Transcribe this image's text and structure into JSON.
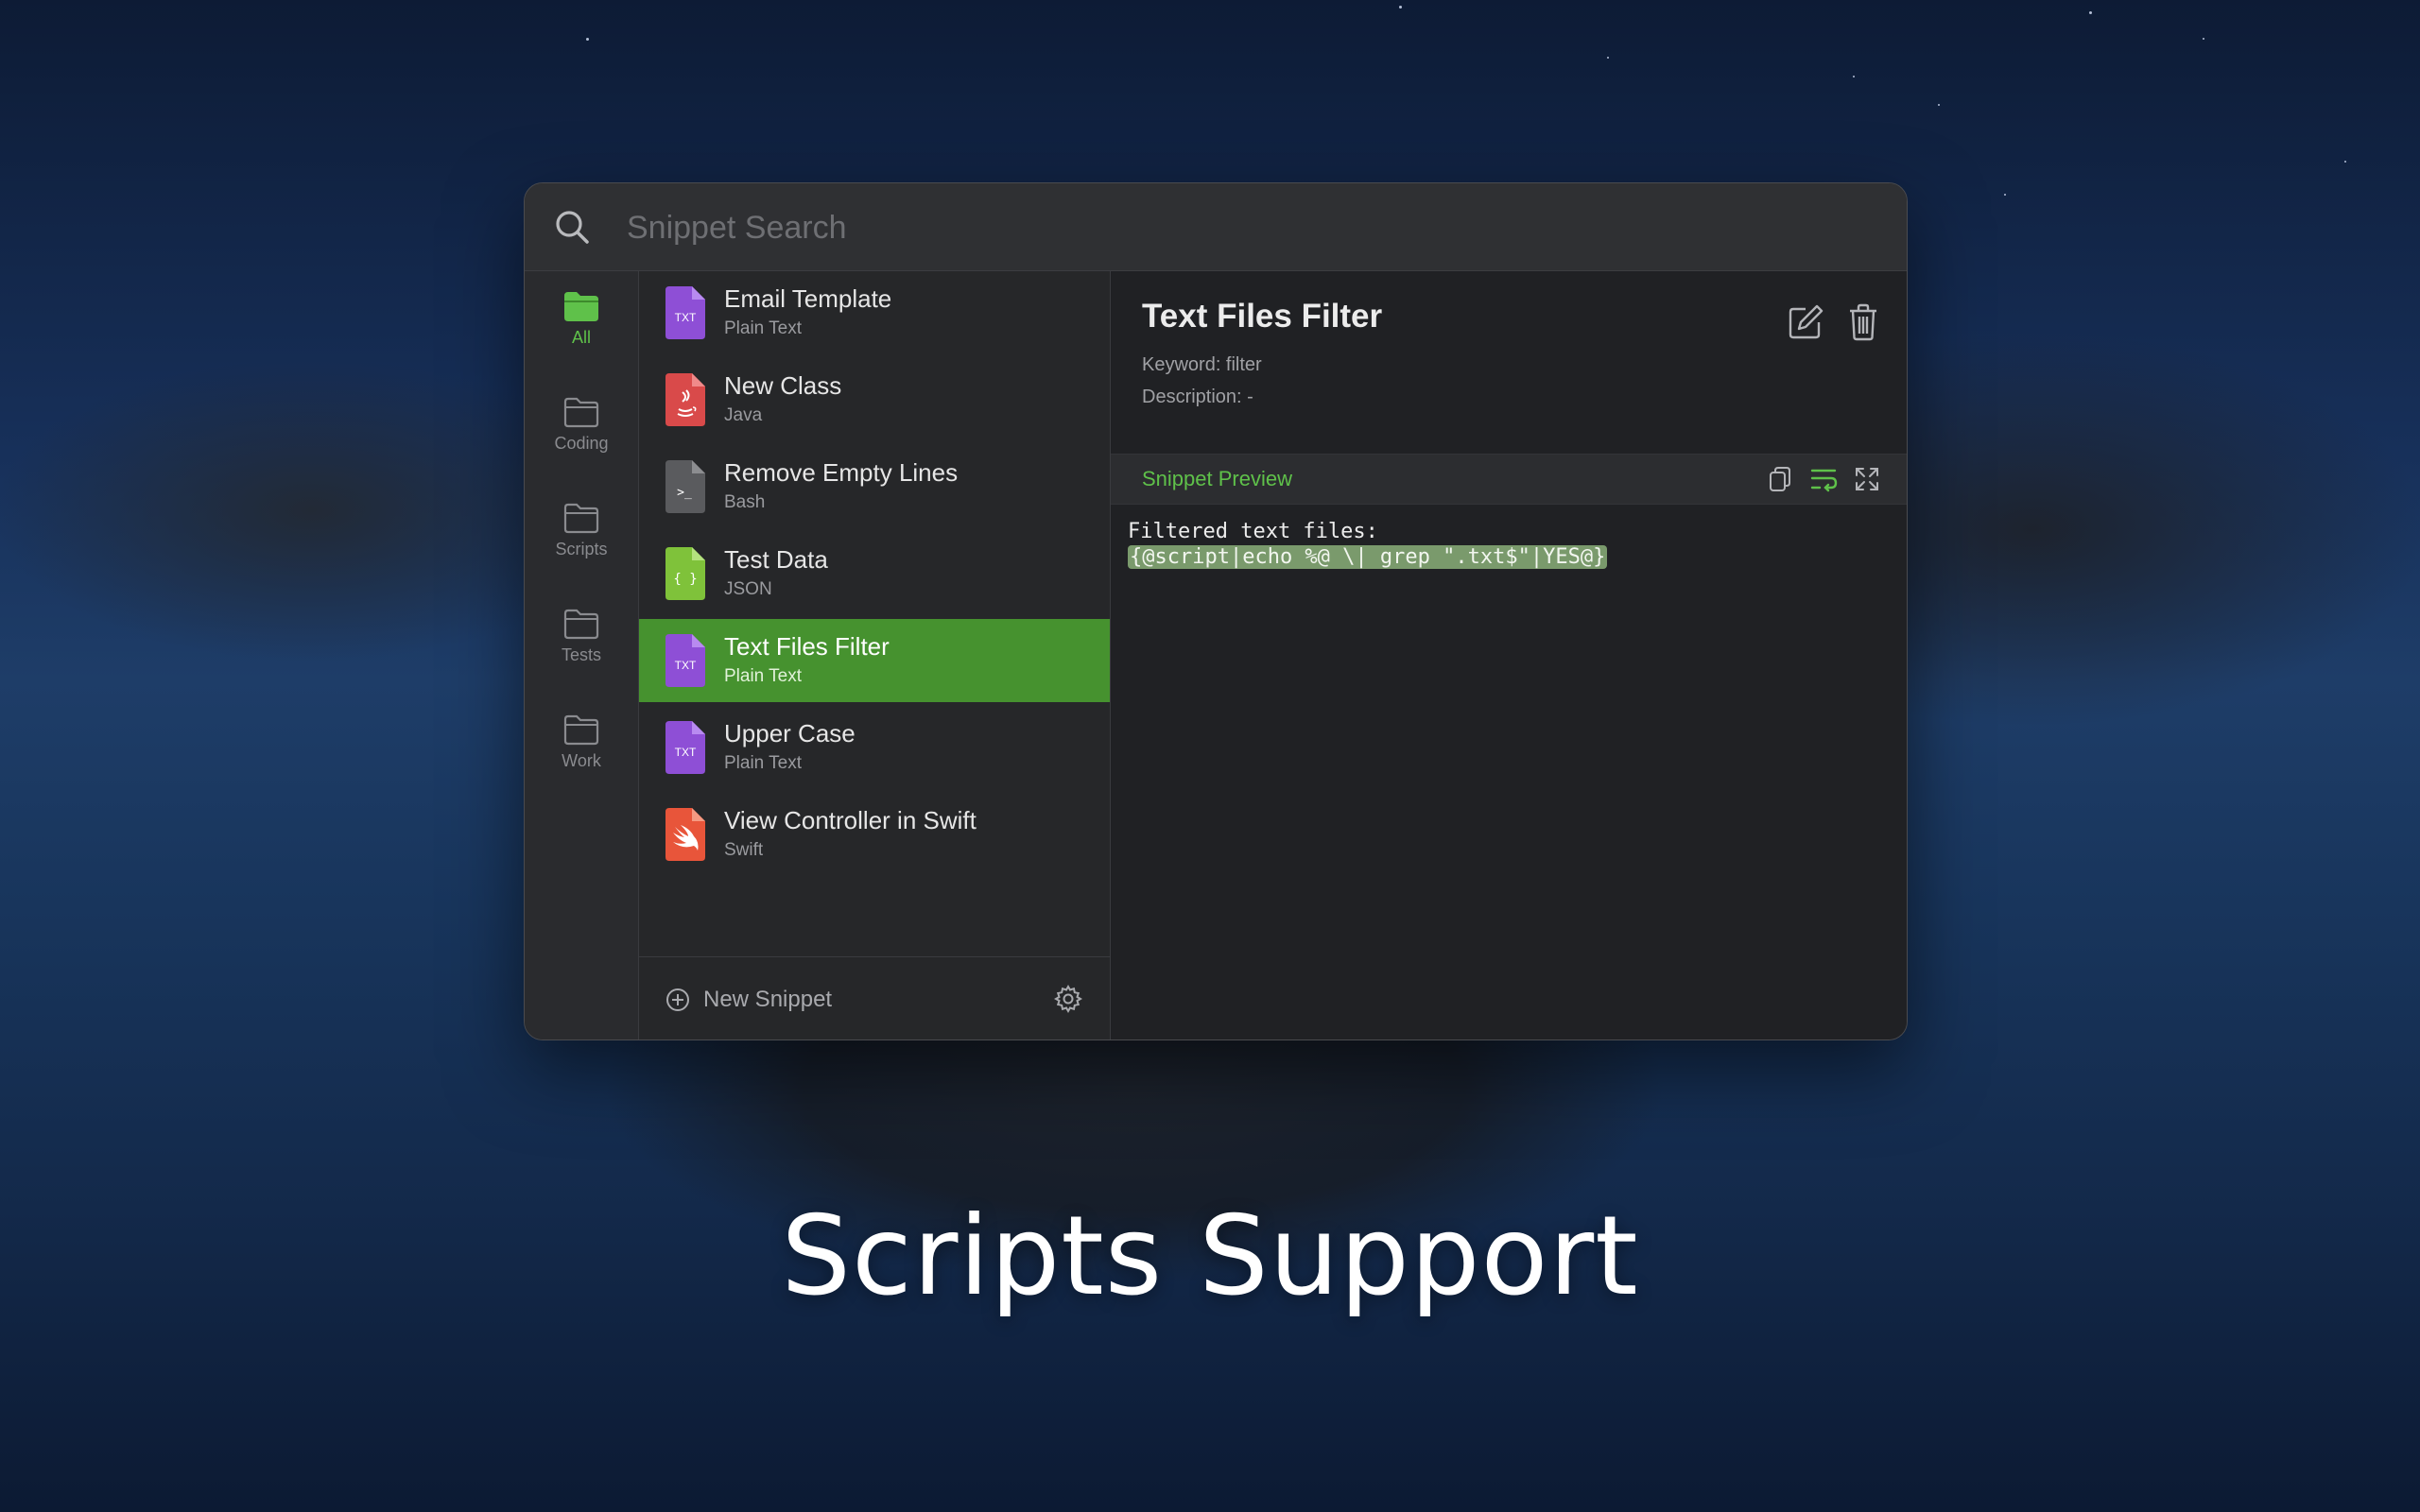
{
  "search": {
    "placeholder": "Snippet Search"
  },
  "sidebar": {
    "items": [
      {
        "label": "All",
        "active": true
      },
      {
        "label": "Coding"
      },
      {
        "label": "Scripts"
      },
      {
        "label": "Tests"
      },
      {
        "label": "Work"
      }
    ]
  },
  "snippets": [
    {
      "title": "Email Template",
      "type": "Plain Text",
      "icon": "txt-file-icon",
      "badge": "TXT",
      "color": "#8e4fd6"
    },
    {
      "title": "New Class",
      "type": "Java",
      "icon": "java-file-icon",
      "color": "#d94a4a"
    },
    {
      "title": "Remove Empty Lines",
      "type": "Bash",
      "icon": "bash-file-icon",
      "badge": ">_",
      "color": "#5a5b5e"
    },
    {
      "title": "Test Data",
      "type": "JSON",
      "icon": "json-file-icon",
      "badge": "{ }",
      "color": "#7fc23a"
    },
    {
      "title": "Text Files Filter",
      "type": "Plain Text",
      "icon": "txt-file-icon",
      "badge": "TXT",
      "color": "#8e4fd6",
      "selected": true
    },
    {
      "title": "Upper Case",
      "type": "Plain Text",
      "icon": "txt-file-icon",
      "badge": "TXT",
      "color": "#8e4fd6"
    },
    {
      "title": "View Controller in Swift",
      "type": "Swift",
      "icon": "swift-file-icon",
      "color": "#e8553a"
    }
  ],
  "footer": {
    "new_snippet_label": "New Snippet"
  },
  "detail": {
    "title": "Text Files Filter",
    "keyword": "Keyword: filter",
    "description": "Description: -",
    "preview_label": "Snippet Preview",
    "code_line1": "Filtered text files:",
    "code_line2": "{@script|echo %@ \\| grep \".txt$\"|YES@}"
  },
  "headline": "Scripts Support",
  "colors": {
    "accent": "#5fc14a",
    "selection": "#46922f",
    "window_bg": "#242528"
  }
}
